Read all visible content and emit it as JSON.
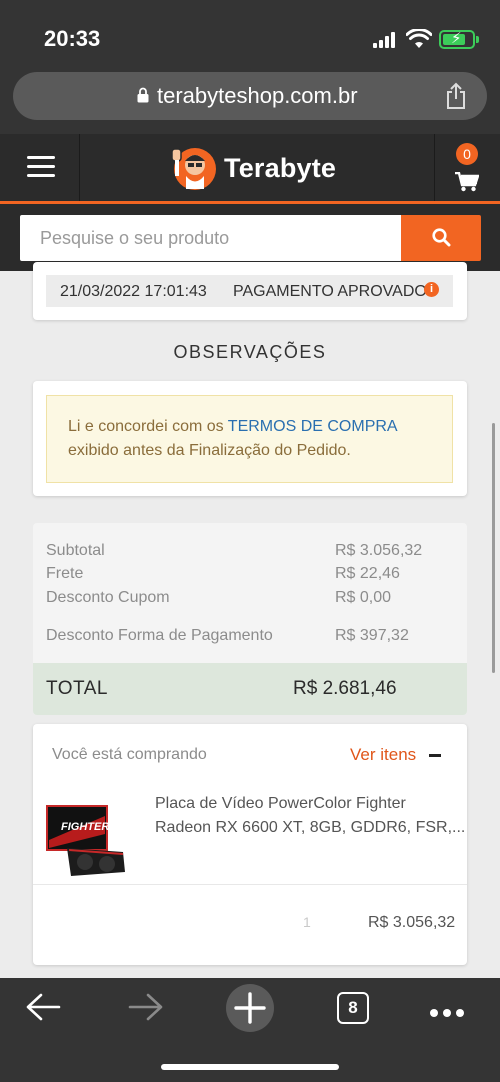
{
  "status_bar": {
    "time": "20:33"
  },
  "browser": {
    "url": "terabyteshop.com.br",
    "tabs_count": "8"
  },
  "header": {
    "brand": "Terabyte",
    "cart_count": "0"
  },
  "search": {
    "placeholder": "Pesquise o seu produto"
  },
  "order_status": {
    "date": "21/03/2022 17:01:43",
    "status": "PAGAMENTO APROVADO"
  },
  "observations": {
    "title": "OBSERVAÇÕES",
    "line1_prefix": "Li e concordei com os ",
    "link_text": "TERMOS DE COMPRA",
    "line2": "exibido antes da Finalização do Pedido."
  },
  "totals": {
    "rows": [
      {
        "label": "Subtotal",
        "value": "R$ 3.056,32"
      },
      {
        "label": "Frete",
        "value": "R$ 22,46"
      },
      {
        "label": "Desconto Cupom",
        "value": "R$ 0,00"
      },
      {
        "label": "Desconto Forma de Pagamento",
        "value": "R$ 397,32"
      }
    ],
    "total_label": "TOTAL",
    "total_value": "R$ 2.681,46"
  },
  "purchase": {
    "label": "Você está comprando",
    "see_items": "Ver itens",
    "product_line1": "Placa de Vídeo PowerColor Fighter",
    "product_line2": "Radeon RX 6600 XT, 8GB, GDDR6, FSR,...",
    "quantity": "1",
    "price": "R$ 3.056,32"
  },
  "colors": {
    "brand_orange": "#f26522",
    "header_dark": "#2b2b2b",
    "link_blue": "#2a6fb0"
  }
}
